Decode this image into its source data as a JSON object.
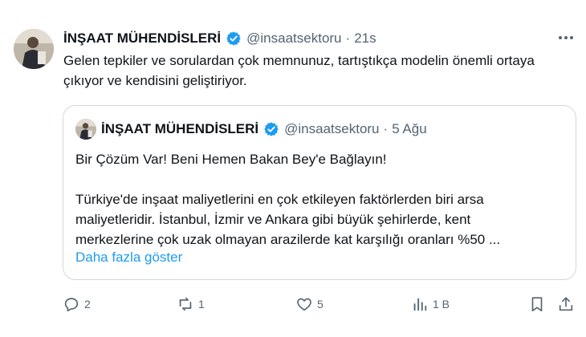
{
  "tweet": {
    "author_name": "İNŞAAT MÜHENDİSLERİ",
    "handle": "@insaatsektoru",
    "separator": "·",
    "time": "21s",
    "text": "Gelen tepkiler ve sorulardan çok memnunuz, tartıştıkça modelin önemli ortaya çıkıyor ve kendisini geliştiriyor.",
    "more_icon": "more-horizontal-icon",
    "verified_color": "#1d9bf0"
  },
  "quote": {
    "author_name": "İNŞAAT MÜHENDİSLERİ",
    "handle": "@insaatsektoru",
    "separator": "·",
    "date": "5 Ağu",
    "title": "Bir Çözüm Var! Beni Hemen Bakan Bey'e Bağlayın!",
    "lines": [
      "Türkiye'de inşaat maliyetlerini en çok etkileyen faktörlerden biri arsa",
      "maliyetleridir. İstanbul, İzmir ve Ankara gibi büyük şehirlerde, kent",
      "merkezlerine çok uzak olmayan arazilerde kat karşılığı oranları %50 ..."
    ],
    "show_more": "Daha fazla göster",
    "link_color": "#1d9bf0"
  },
  "actions": {
    "reply": {
      "icon": "reply-icon",
      "count": "2"
    },
    "retweet": {
      "icon": "retweet-icon",
      "count": "1"
    },
    "like": {
      "icon": "heart-icon",
      "count": "5"
    },
    "views": {
      "icon": "views-icon",
      "count": "1 B"
    },
    "bookmark": {
      "icon": "bookmark-icon"
    },
    "share": {
      "icon": "share-icon"
    }
  }
}
